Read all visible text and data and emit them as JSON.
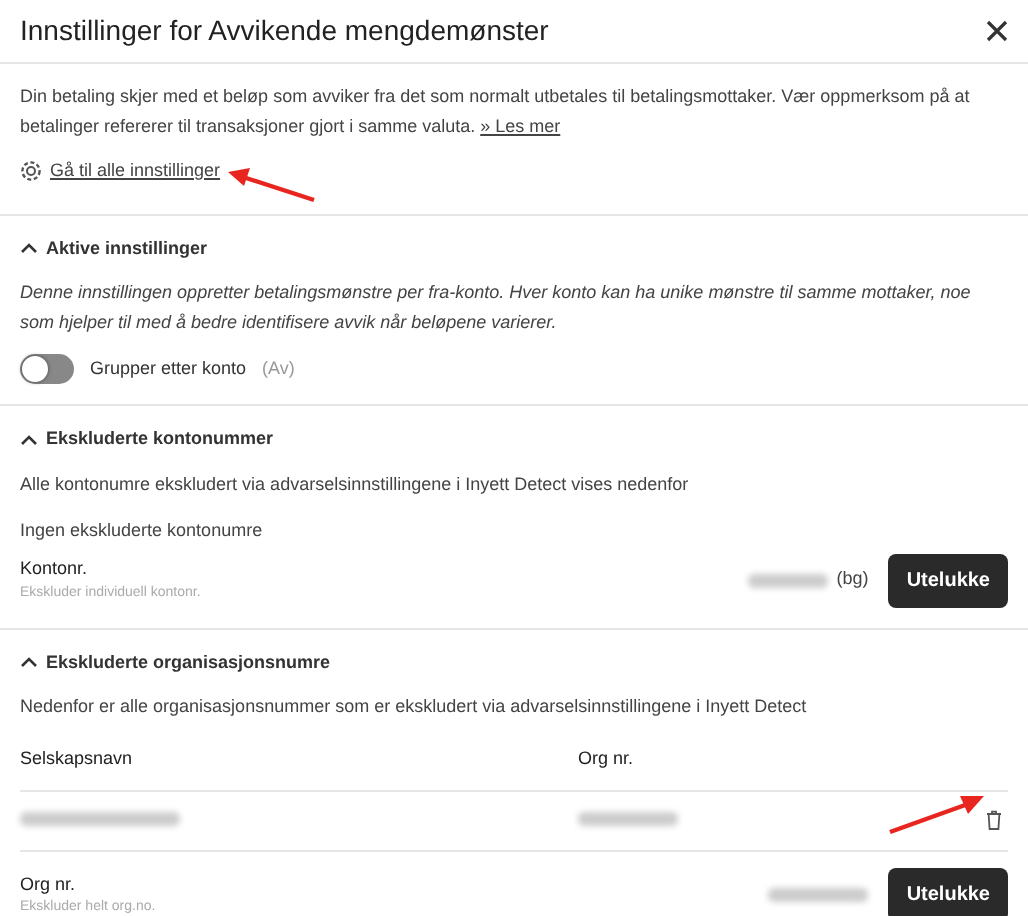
{
  "dialog": {
    "title": "Innstillinger for Avvikende mengdemønster"
  },
  "intro": {
    "text": "Din betaling skjer med et beløp som avviker fra det som normalt utbetales til betalingsmottaker. Vær oppmerksom på at betalinger refererer til transaksjoner gjort i samme valuta.",
    "link": "» Les mer"
  },
  "settings_link": "Gå til alle innstillinger",
  "sections": [
    {
      "kind": "toggle",
      "title": "Aktive innstillinger",
      "expanded": true,
      "description": "Denne innstillingen oppretter betalingsmønstre per fra-konto. Hver konto kan ha unike mønstre til samme mottaker, noe som hjelper til med å bedre identifisere avvik når beløpene varierer.",
      "toggle": {
        "label": "Grupper etter konto",
        "state_text": "(Av)",
        "on": false
      }
    },
    {
      "kind": "account",
      "title": "Ekskluderte kontonummer",
      "expanded": true,
      "description": "Alle kontonumre ekskludert via advarselsinnstillingene i Inyett Detect vises nedenfor",
      "empty_text": "Ingen ekskluderte kontonumre",
      "field": {
        "label": "Kontonr.",
        "hint": "Ekskluder individuell kontonr.",
        "suffix": "(bg)"
      },
      "button": "Utelukke"
    },
    {
      "kind": "org",
      "title": "Ekskluderte organisasjonsnumre",
      "expanded": true,
      "description": "Nedenfor er alle organisasjonsnummer som er ekskludert via advarselsinnstillingene i Inyett Detect",
      "table": {
        "columns": [
          "Selskapsnavn",
          "Org nr."
        ],
        "rows": [
          {
            "blurred": true
          }
        ]
      },
      "field": {
        "label": "Org nr.",
        "hint": "Ekskluder helt org.no."
      },
      "button": "Utelukke"
    }
  ]
}
